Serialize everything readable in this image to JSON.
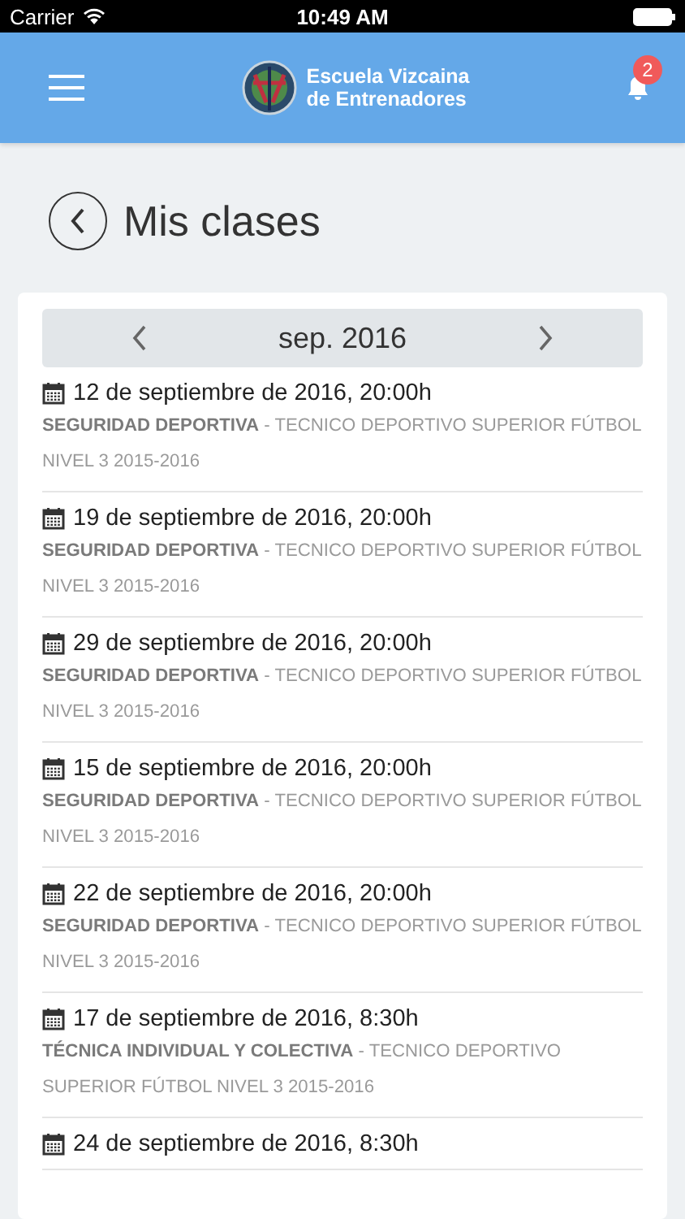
{
  "status_bar": {
    "carrier": "Carrier",
    "time": "10:49 AM"
  },
  "header": {
    "logo_lines": [
      "Escuela Vizcaina",
      "de Entrenadores"
    ],
    "notifications": "2"
  },
  "page": {
    "title": "Mis clases"
  },
  "month_nav": {
    "label": "sep. 2016"
  },
  "classes": [
    {
      "date": "12 de septiembre de 2016, 20:00h",
      "description": "**SEGURIDAD DEPORTIVA** - TECNICO DEPORTIVO SUPERIOR FÚTBOL NIVEL 3 2015-2016"
    },
    {
      "date": "19 de septiembre de 2016, 20:00h",
      "description": "**SEGURIDAD DEPORTIVA** - TECNICO DEPORTIVO SUPERIOR FÚTBOL NIVEL 3 2015-2016"
    },
    {
      "date": "29 de septiembre de 2016, 20:00h",
      "description": "**SEGURIDAD DEPORTIVA** - TECNICO DEPORTIVO SUPERIOR FÚTBOL NIVEL 3 2015-2016"
    },
    {
      "date": "15 de septiembre de 2016, 20:00h",
      "description": "**SEGURIDAD DEPORTIVA** - TECNICO DEPORTIVO SUPERIOR FÚTBOL NIVEL 3 2015-2016"
    },
    {
      "date": "22 de septiembre de 2016, 20:00h",
      "description": "**SEGURIDAD DEPORTIVA** - TECNICO DEPORTIVO SUPERIOR FÚTBOL NIVEL 3 2015-2016"
    },
    {
      "date": "17 de septiembre de 2016, 8:30h",
      "description": "**TÉCNICA INDIVIDUAL Y COLECTIVA** - TECNICO DEPORTIVO SUPERIOR FÚTBOL NIVEL 3 2015-2016"
    },
    {
      "date": "24 de septiembre de 2016, 8:30h"
    }
  ]
}
